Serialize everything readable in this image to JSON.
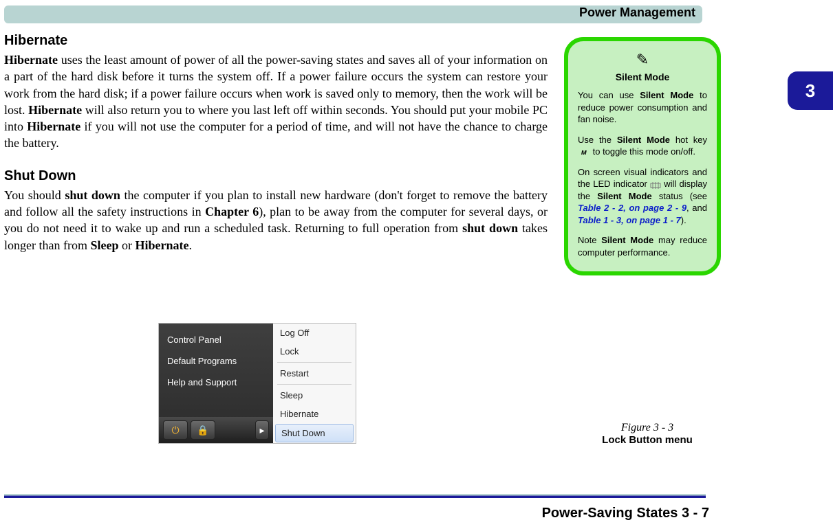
{
  "header": {
    "title": "Power Management"
  },
  "chapter_tab": "3",
  "sections": {
    "hibernate": {
      "heading": "Hibernate",
      "p1_a": "Hibernate",
      "p1_b": " uses the least amount of power of all the power-saving states and saves all of your information on a part of the hard disk before it turns the system off. If a power failure occurs the system can restore your work from the hard disk; if a power failure occurs when work is saved only to memory, then the work will be lost. ",
      "p1_c": "Hibernate",
      "p1_d": " will also return you to where you last left off within seconds. You should put your mobile PC into ",
      "p1_e": "Hibernate",
      "p1_f": " if you will not use the computer for a period of time, and will not have the chance to charge the battery."
    },
    "shutdown": {
      "heading": "Shut Down",
      "p1_a": "You should ",
      "p1_b": "shut down",
      "p1_c": " the computer if you plan to install new hardware (don't forget to remove the battery and follow all the safety instructions in ",
      "p1_d": "Chapter 6",
      "p1_e": "), plan to be away from the computer for several days, or you do not need it to wake up and run a scheduled task. Returning to full operation from ",
      "p1_f": "shut down",
      "p1_g": " takes longer than from ",
      "p1_h": "Sleep",
      "p1_i": " or ",
      "p1_j": "Hibernate",
      "p1_k": "."
    }
  },
  "sidebar": {
    "title": "Silent Mode",
    "p1_a": "You can use ",
    "p1_b": "Silent Mode",
    "p1_c": " to reduce power consumption and fan noise.",
    "p2_a": "Use the ",
    "p2_b": "Silent Mode",
    "p2_c": " hot key ",
    "p2_d": " to toggle this mode on/off.",
    "p3_a": "On screen visual indicators and the ",
    "p3_led": "LED",
    "p3_b": " indicator ",
    "p3_c": " will display the ",
    "p3_d": "Silent Mode",
    "p3_e": " status (see ",
    "p3_xref1": "Table 2 - 2, on page 2 - 9",
    "p3_f": ", and ",
    "p3_xref2": "Table 1 - 3, on page 1 - 7",
    "p3_g": ").",
    "p4_a": "Note ",
    "p4_b": "Silent Mode",
    "p4_c": " may reduce computer performance."
  },
  "vista_menu": {
    "left": [
      "Control Panel",
      "Default Programs",
      "Help and Support"
    ],
    "right_top": [
      "Log Off",
      "Lock"
    ],
    "right_mid": [
      "Restart"
    ],
    "right_bot": [
      "Sleep",
      "Hibernate",
      "Shut Down"
    ]
  },
  "figure": {
    "num": "Figure 3 - 3",
    "title": "Lock Button menu"
  },
  "footer": "Power-Saving States  3  -  7"
}
